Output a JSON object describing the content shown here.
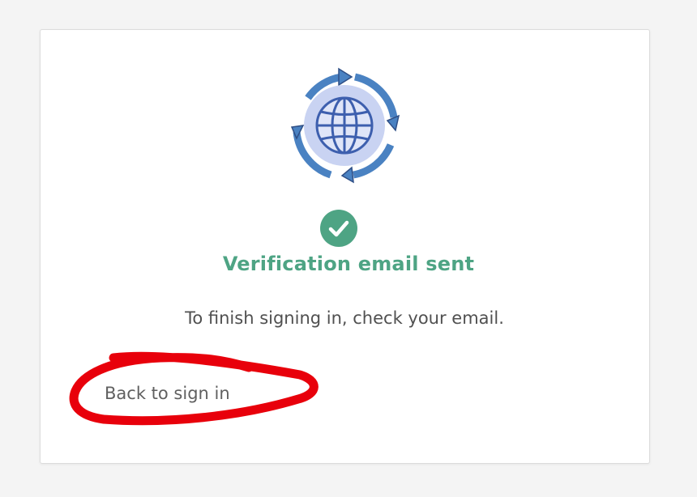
{
  "dialog": {
    "status_title": "Verification email sent",
    "message": "To finish signing in, check your email.",
    "back_link": "Back to sign in"
  },
  "icons": {
    "hero": "globe-sync-icon",
    "status": "check-circle-icon"
  },
  "colors": {
    "success": "#4ea484",
    "annotation": "#e8000b",
    "globe_blue": "#4a82c2",
    "globe_fill": "#c9d3f2"
  }
}
